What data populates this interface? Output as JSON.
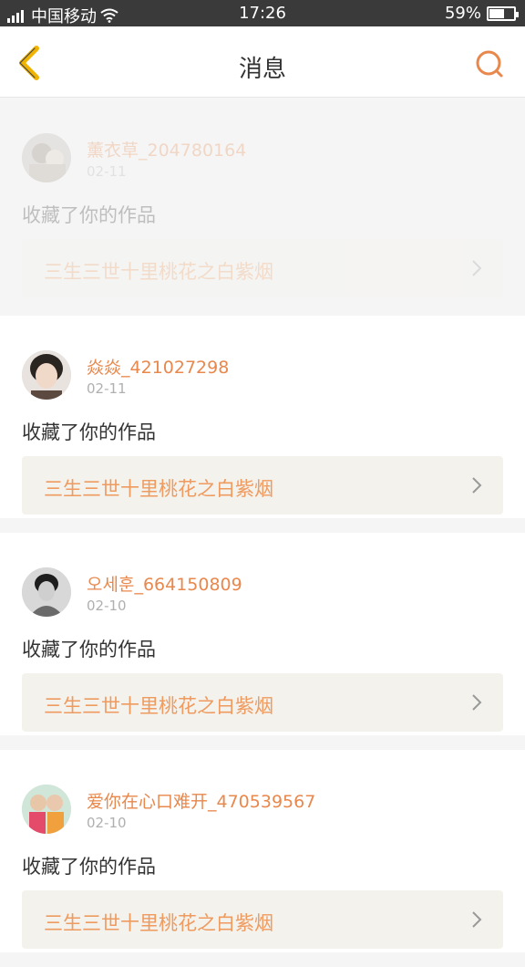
{
  "status_bar": {
    "carrier": "中国移动",
    "time": "17:26",
    "battery": "59%",
    "battery_level": 0.59
  },
  "header": {
    "title": "消息",
    "accent_color": "#e8884d"
  },
  "messages": [
    {
      "username": "薰衣草_204780164",
      "date": "02-11",
      "action": "收藏了你的作品",
      "work_title": "三生三世十里桃花之白紫烟",
      "avatar": "avatar-photo"
    },
    {
      "username": "焱焱_421027298",
      "date": "02-11",
      "action": "收藏了你的作品",
      "work_title": "三生三世十里桃花之白紫烟",
      "avatar": "avatar-photo"
    },
    {
      "username": "오세훈_664150809",
      "date": "02-10",
      "action": "收藏了你的作品",
      "work_title": "三生三世十里桃花之白紫烟",
      "avatar": "avatar-photo"
    },
    {
      "username": "爱你在心口难开_470539567",
      "date": "02-10",
      "action": "收藏了你的作品",
      "work_title": "三生三世十里桃花之白紫烟",
      "avatar": "avatar-photo"
    }
  ]
}
